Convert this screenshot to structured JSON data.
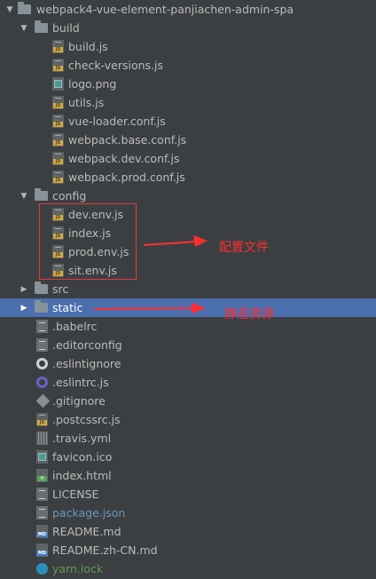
{
  "tree": {
    "root": {
      "label": "webpack4-vue-element-panjiachen-admin-spa",
      "expanded": true
    },
    "build": {
      "label": "build",
      "expanded": true,
      "files": [
        "build.js",
        "check-versions.js",
        "logo.png",
        "utils.js",
        "vue-loader.conf.js",
        "webpack.base.conf.js",
        "webpack.dev.conf.js",
        "webpack.prod.conf.js"
      ]
    },
    "config": {
      "label": "config",
      "expanded": true,
      "files": [
        "dev.env.js",
        "index.js",
        "prod.env.js",
        "sit.env.js"
      ]
    },
    "src": {
      "label": "src",
      "expanded": false
    },
    "static": {
      "label": "static",
      "expanded": false,
      "selected": true
    },
    "root_files": [
      ".babelrc",
      ".editorconfig",
      ".eslintignore",
      ".eslintrc.js",
      ".gitignore",
      ".postcssrc.js",
      ".travis.yml",
      "favicon.ico",
      "index.html",
      "LICENSE",
      "package.json",
      "README.md",
      "README.zh-CN.md",
      "yarn.lock"
    ]
  },
  "annotations": {
    "config_note": "配置文件",
    "static_note": "静态资源",
    "color": "#ff2d2d"
  },
  "colors": {
    "background": "#3c3f41",
    "selection": "#4b6eaf",
    "text": "#bbbbbb",
    "modified_blue": "#6897bb",
    "vcs_green": "#629755"
  }
}
